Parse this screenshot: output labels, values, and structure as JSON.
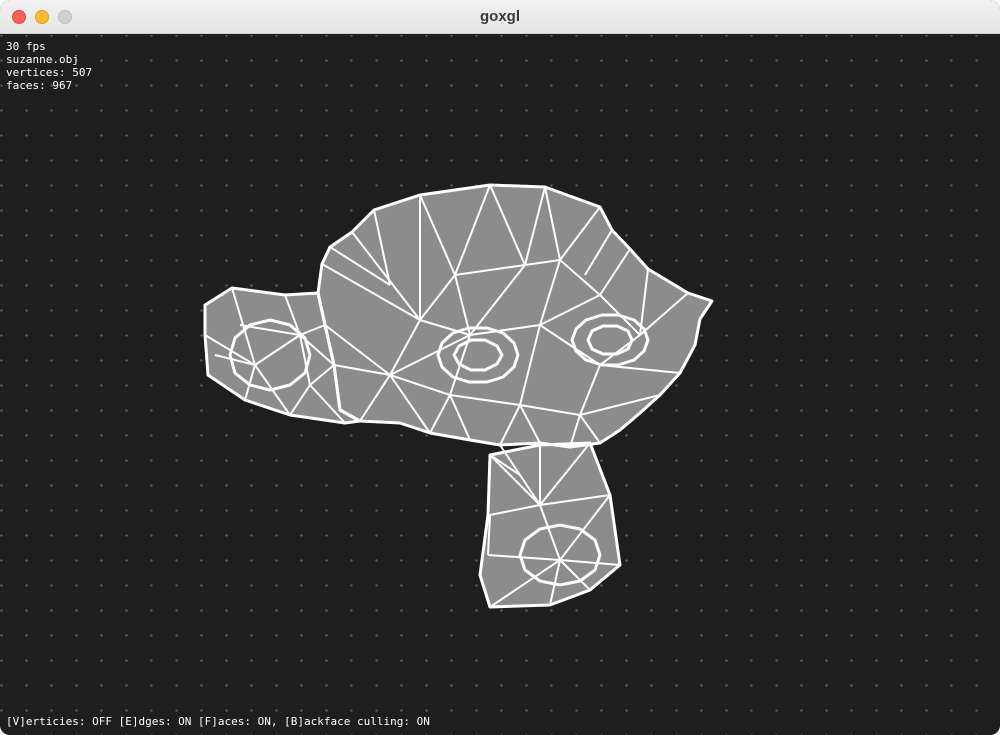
{
  "window": {
    "title": "goxgl"
  },
  "hud": {
    "fps": "30 fps",
    "file": "suzanne.obj",
    "vertices": "vertices: 507",
    "faces": "faces: 967"
  },
  "status": {
    "text": "[V]erticies: OFF [E]dges: ON [F]aces: ON, [B]ackface culling: ON"
  },
  "colors": {
    "background": "#1e1e1e",
    "face_fill": "#8c8c8c",
    "edge": "#ffffff",
    "grid_dot": "#5a5a5a"
  },
  "model": {
    "name": "suzanne",
    "render_mode": "faces-and-edges"
  }
}
